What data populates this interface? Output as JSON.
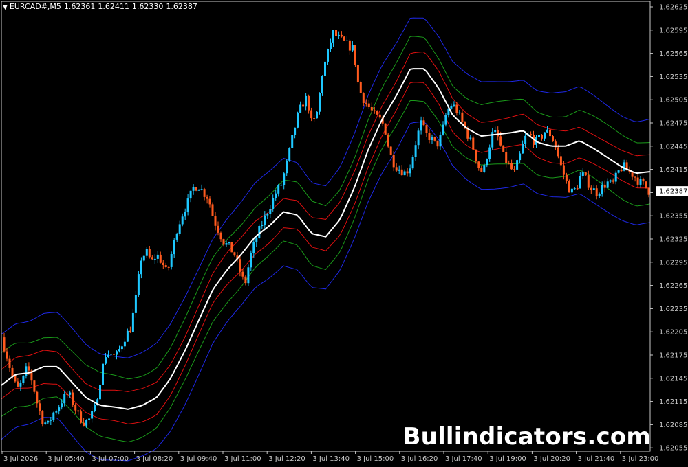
{
  "header": {
    "symbol": "EURCAD#,M5",
    "open": "1.62361",
    "high": "1.62411",
    "low": "1.62330",
    "close": "1.62387"
  },
  "watermark": "Bullindicators.com",
  "chart_data": {
    "type": "candlestick",
    "price_axis": {
      "ticks": [
        "1.62625",
        "1.62595",
        "1.62565",
        "1.62535",
        "1.62505",
        "1.62475",
        "1.62445",
        "1.62415",
        "1.62385",
        "1.62355",
        "1.62325",
        "1.62295",
        "1.62265",
        "1.62235",
        "1.62205",
        "1.62175",
        "1.62145",
        "1.62115",
        "1.62085",
        "1.62055"
      ],
      "ylim": [
        1.6205,
        1.6263
      ],
      "current_price": "1.62387"
    },
    "time_axis": {
      "ticks": [
        "3 Jul 2026",
        "3 Jul 05:40",
        "3 Jul 07:00",
        "3 Jul 08:20",
        "3 Jul 09:40",
        "3 Jul 11:00",
        "3 Jul 12:20",
        "3 Jul 13:40",
        "3 Jul 15:00",
        "3 Jul 16:20",
        "3 Jul 17:40",
        "3 Jul 19:00",
        "3 Jul 20:20",
        "3 Jul 21:40",
        "3 Jul 23:00"
      ]
    },
    "colors": {
      "bull": "#1ec8ff",
      "bear": "#ff5a1e",
      "mid": "#ffffff",
      "band1": "#e01010",
      "band2": "#1a9a1a",
      "band3": "#1e28e6",
      "axis": "#c8c8c8",
      "bg": "#000000"
    },
    "close_path": [
      1.62198,
      1.62175,
      1.6215,
      1.6213,
      1.6214,
      1.6216,
      1.6214,
      1.6211,
      1.6209,
      1.62085,
      1.621,
      1.62108,
      1.6212,
      1.62125,
      1.6211,
      1.62095,
      1.62088,
      1.62092,
      1.62105,
      1.6214,
      1.62175,
      1.62178,
      1.62172,
      1.62185,
      1.622,
      1.6221,
      1.6225,
      1.623,
      1.62308,
      1.62295,
      1.62305,
      1.62295,
      1.6228,
      1.6231,
      1.6234,
      1.62358,
      1.62372,
      1.6239,
      1.62395,
      1.62385,
      1.62378,
      1.6235,
      1.62335,
      1.6232,
      1.62315,
      1.62305,
      1.62285,
      1.62265,
      1.623,
      1.62322,
      1.6234,
      1.62355,
      1.6237,
      1.62385,
      1.62395,
      1.6242,
      1.6245,
      1.6248,
      1.62498,
      1.62508,
      1.6247,
      1.6249,
      1.6254,
      1.62565,
      1.62592,
      1.62585,
      1.6258,
      1.62575,
      1.6257,
      1.6252,
      1.62505,
      1.62495,
      1.62485,
      1.6248,
      1.6247,
      1.62435,
      1.6242,
      1.62415,
      1.6241,
      1.6242,
      1.6245,
      1.62475,
      1.6246,
      1.62455,
      1.62445,
      1.6246,
      1.6249,
      1.625,
      1.6249,
      1.62475,
      1.6246,
      1.62445,
      1.6242,
      1.6241,
      1.6244,
      1.62465,
      1.62455,
      1.6243,
      1.6242,
      1.6241,
      1.6243,
      1.62455,
      1.6246,
      1.6245,
      1.62455,
      1.62465,
      1.6246,
      1.62445,
      1.6242,
      1.624,
      1.62385,
      1.6239,
      1.6241,
      1.624,
      1.6239,
      1.62385,
      1.62392,
      1.62398,
      1.62395,
      1.6241,
      1.6242,
      1.62412,
      1.62408,
      1.624,
      1.62395,
      1.62387
    ],
    "mid_line": [
      1.62136,
      1.6215,
      1.62152,
      1.6216,
      1.6216,
      1.6214,
      1.6212,
      1.6211,
      1.62108,
      1.62105,
      1.6211,
      1.6212,
      1.62145,
      1.6218,
      1.6222,
      1.6226,
      1.62285,
      1.62305,
      1.62328,
      1.62342,
      1.6236,
      1.62356,
      1.62332,
      1.62328,
      1.6235,
      1.6239,
      1.6244,
      1.6248,
      1.6251,
      1.62545,
      1.62545,
      1.6252,
      1.62485,
      1.62468,
      1.62458,
      1.6246,
      1.62462,
      1.62465,
      1.6245,
      1.62445,
      1.62445,
      1.62452,
      1.62442,
      1.6243,
      1.62418,
      1.6241,
      1.62412
    ],
    "band_offsets": [
      0.0002,
      0.0004,
      0.00068
    ]
  }
}
